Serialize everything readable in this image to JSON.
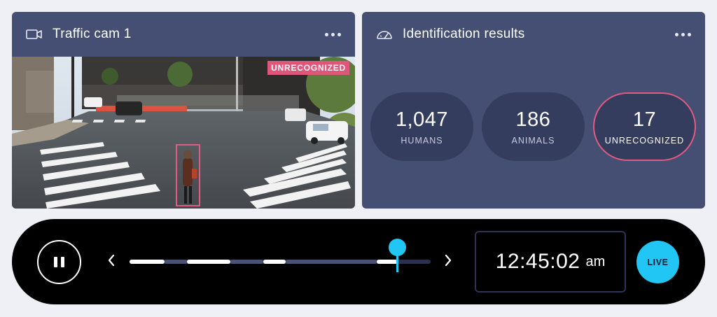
{
  "camera_panel": {
    "title": "Traffic cam 1",
    "icon": "video-camera-icon",
    "menu_icon": "more-horizontal-icon",
    "detection_tag": "UNRECOGNIZED"
  },
  "results_panel": {
    "title": "Identification results",
    "icon": "gauge-icon",
    "menu_icon": "more-horizontal-icon",
    "stats": [
      {
        "value": "1,047",
        "label": "HUMANS"
      },
      {
        "value": "186",
        "label": "ANIMALS"
      },
      {
        "value": "17",
        "label": "UNRECOGNIZED"
      }
    ]
  },
  "player": {
    "pause_icon": "pause-icon",
    "prev_icon": "chevron-left-icon",
    "next_icon": "chevron-right-icon",
    "playhead_fraction": 0.89,
    "time": "12:45:02",
    "ampm": "am",
    "live_label": "LIVE"
  },
  "colors": {
    "panel": "#454e73",
    "stat_pill": "#353d5e",
    "alert": "#e35b80",
    "accent": "#22c6f5"
  }
}
